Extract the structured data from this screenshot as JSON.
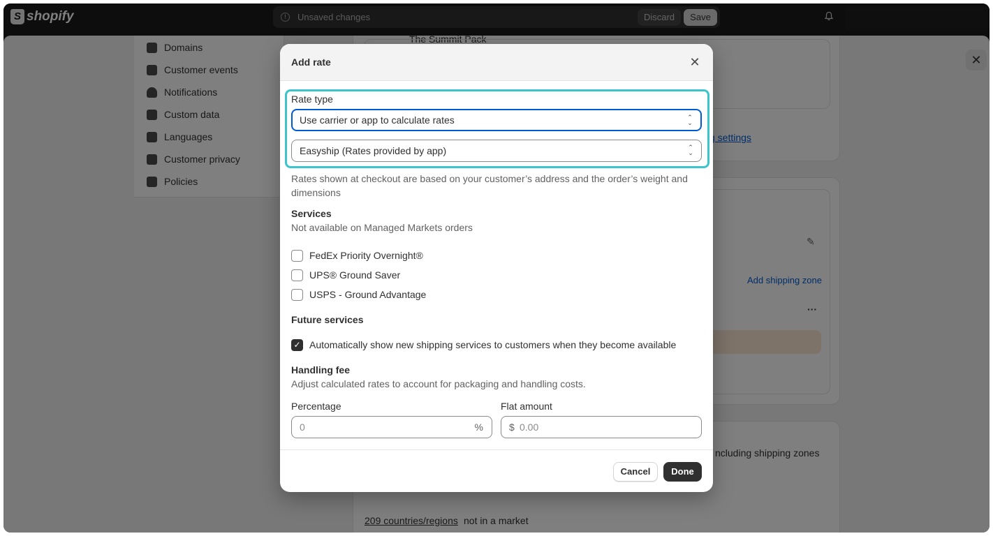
{
  "topbar": {
    "brand": "shopify",
    "unsaved_text": "Unsaved changes",
    "discard_label": "Discard",
    "save_label": "Save"
  },
  "background": {
    "nav_items": [
      {
        "label": "Domains",
        "icon": "domains-icon"
      },
      {
        "label": "Customer events",
        "icon": "cursor-icon"
      },
      {
        "label": "Notifications",
        "icon": "bell-icon"
      },
      {
        "label": "Custom data",
        "icon": "database-icon"
      },
      {
        "label": "Languages",
        "icon": "languages-icon"
      },
      {
        "label": "Customer privacy",
        "icon": "lock-icon"
      },
      {
        "label": "Policies",
        "icon": "policy-icon"
      }
    ],
    "product_name": "The Summit Pack",
    "settings_link": "g settings",
    "add_zone_link": "Add shipping zone",
    "markets_text": "ncluding shipping zones",
    "countries_link": "209 countries/regions",
    "countries_suffix": "not in a market"
  },
  "modal": {
    "title": "Add rate",
    "rate_type_label": "Rate type",
    "rate_type_value": "Use carrier or app to calculate rates",
    "provider_value": "Easyship (Rates provided by app)",
    "rate_help": "Rates shown at checkout are based on your customer’s address and the order’s weight and dimensions",
    "services_heading": "Services",
    "services_sub": "Not available on Managed Markets orders",
    "services": [
      {
        "label": "FedEx Priority Overnight®",
        "checked": false
      },
      {
        "label": "UPS® Ground Saver",
        "checked": false
      },
      {
        "label": "USPS - Ground Advantage",
        "checked": false
      }
    ],
    "future_heading": "Future services",
    "future_option": "Automatically show new shipping services to customers when they become available",
    "future_checked": true,
    "handling_heading": "Handling fee",
    "handling_sub": "Adjust calculated rates to account for packaging and handling costs.",
    "percentage_label": "Percentage",
    "percentage_placeholder": "0",
    "percentage_suffix": "%",
    "flat_label": "Flat amount",
    "flat_prefix": "$",
    "flat_placeholder": "0.00",
    "cancel_label": "Cancel",
    "done_label": "Done"
  },
  "colors": {
    "highlight": "#3cc4cc",
    "focus": "#005bd3",
    "primary_button": "#303030"
  }
}
